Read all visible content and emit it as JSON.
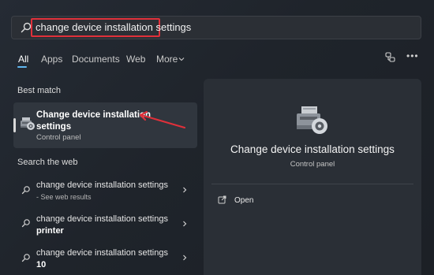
{
  "search": {
    "query": "change device installation settings"
  },
  "tabs": [
    "All",
    "Apps",
    "Documents",
    "Web",
    "More"
  ],
  "toolbar": {
    "more_options": "•••"
  },
  "best_match": {
    "heading": "Best match",
    "title": "Change device installation settings",
    "subtitle": "Control panel"
  },
  "web": {
    "heading": "Search the web",
    "items": [
      {
        "text": "change device installation settings",
        "bold": "",
        "sub": "- See web results"
      },
      {
        "text": "change device installation settings",
        "bold": "printer",
        "sub": ""
      },
      {
        "text": "change device installation settings",
        "bold": "10",
        "sub": ""
      }
    ]
  },
  "preview": {
    "title": "Change device installation settings",
    "subtitle": "Control panel",
    "actions": [
      {
        "label": "Open",
        "icon": "open-external-icon"
      }
    ]
  },
  "colors": {
    "highlight": "#e0303a",
    "accent": "#60b6f0",
    "arrow": "#e0303a"
  }
}
